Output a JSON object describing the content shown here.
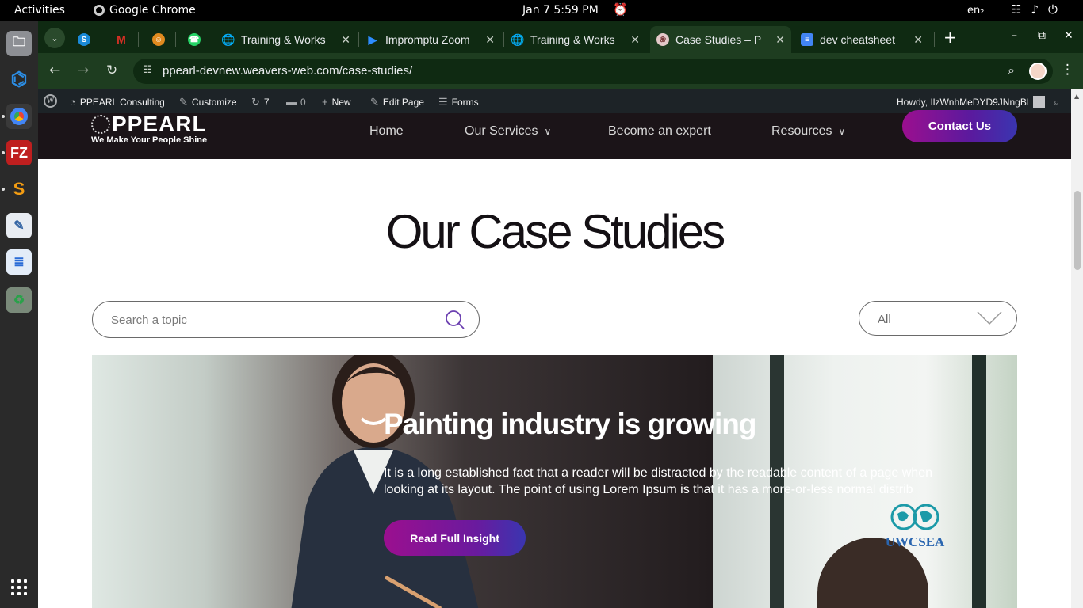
{
  "desktop": {
    "activities": "Activities",
    "app_name": "Google Chrome",
    "clock": "Jan 7  5:59 PM",
    "lang": "en₂"
  },
  "dock": {
    "items": [
      "files-icon",
      "vscode-icon",
      "chrome-icon",
      "filezilla-icon",
      "sublime-icon",
      "text-editor-icon",
      "docs-viewer-icon",
      "trash-icon"
    ]
  },
  "tabs": [
    {
      "title": "",
      "icon": "skype",
      "color": "#1a8ad8"
    },
    {
      "title": "",
      "icon": "gmail",
      "color": "#d93025"
    },
    {
      "title": "",
      "icon": "mascot",
      "color": "#e08a1f"
    },
    {
      "title": "",
      "icon": "whatsapp",
      "color": "#25d366"
    },
    {
      "title": "Training & Works",
      "icon": "globe",
      "color": "#9aa0a6"
    },
    {
      "title": "Impromptu Zoom",
      "icon": "zoom",
      "color": "#2d8cff"
    },
    {
      "title": "Training & Works",
      "icon": "globe",
      "color": "#9aa0a6"
    },
    {
      "title": "Case Studies – P",
      "icon": "ppearl",
      "color": "#e4c9c9"
    },
    {
      "title": "dev cheatsheet",
      "icon": "docs",
      "color": "#4285f4"
    }
  ],
  "omnibox": {
    "url": "ppearl-devnew.weavers-web.com/case-studies/"
  },
  "wpbar": {
    "site": "PPEARL Consulting",
    "customize": "Customize",
    "updates": "7",
    "comments": "0",
    "new": "New",
    "edit": "Edit Page",
    "forms": "Forms",
    "howdy": "Howdy, IlzWnhMeDYD9JNngBl"
  },
  "site": {
    "logo_brand": "PPEARL",
    "logo_tag": "We Make Your People Shine",
    "nav": [
      "Home",
      "Our Services",
      "Become an expert",
      "Resources"
    ],
    "contact": "Contact Us"
  },
  "page": {
    "title": "Our Case Studies",
    "search_placeholder": "Search a topic",
    "filter_value": "All"
  },
  "hero": {
    "headline": "Painting industry is growing",
    "body": "It is a long established fact that a reader will be distracted by the readable content of a page when looking at its layout. The point of using Lorem Ipsum is that it has a more-or-less normal distrib",
    "cta": "Read Full Insight",
    "partner_logo": "UWCSEA"
  }
}
